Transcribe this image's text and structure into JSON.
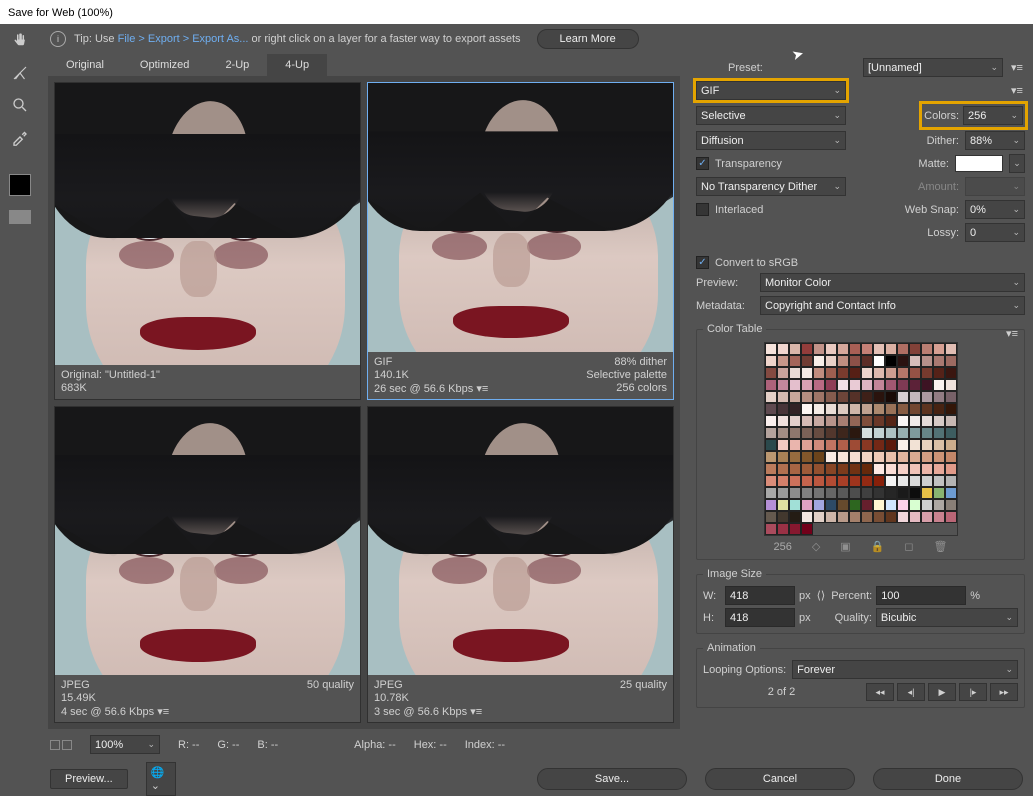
{
  "window": {
    "title": "Save for Web (100%)"
  },
  "tip": {
    "prefix": "Tip: Use ",
    "path": "File > Export > Export As...",
    "suffix": "  or right click on a layer for a faster way to export assets",
    "learn_more": "Learn More"
  },
  "tabs": {
    "original": "Original",
    "optimized": "Optimized",
    "two_up": "2-Up",
    "four_up": "4-Up"
  },
  "cells": [
    {
      "l1": "Original: \"Untitled-1\"",
      "r1": "",
      "l2": "683K",
      "r2": "",
      "l3": "",
      "r3": ""
    },
    {
      "l1": "GIF",
      "r1": "88% dither",
      "l2": "140.1K",
      "r2": "Selective palette",
      "l3": "26 sec @ 56.6 Kbps",
      "r3": "256 colors",
      "menu": "▾≡"
    },
    {
      "l1": "JPEG",
      "r1": "50 quality",
      "l2": "15.49K",
      "r2": "",
      "l3": "4 sec @ 56.6 Kbps",
      "r3": "",
      "menu": "▾≡"
    },
    {
      "l1": "JPEG",
      "r1": "25 quality",
      "l2": "10.78K",
      "r2": "",
      "l3": "3 sec @ 56.6 Kbps",
      "r3": "",
      "menu": "▾≡"
    }
  ],
  "settings": {
    "preset_label": "Preset:",
    "preset_value": "[Unnamed]",
    "format": "GIF",
    "reduction": "Selective",
    "colors_label": "Colors:",
    "colors_value": "256",
    "dithering": "Diffusion",
    "dither_label": "Dither:",
    "dither_value": "88%",
    "transparency_label": "Transparency",
    "matte_label": "Matte:",
    "trans_dither": "No Transparency Dither",
    "amount_label": "Amount:",
    "amount_value": "",
    "interlaced_label": "Interlaced",
    "websnap_label": "Web Snap:",
    "websnap_value": "0%",
    "lossy_label": "Lossy:",
    "lossy_value": "0",
    "convert_srgb": "Convert to sRGB",
    "preview_label": "Preview:",
    "preview_value": "Monitor Color",
    "metadata_label": "Metadata:",
    "metadata_value": "Copyright and Contact Info"
  },
  "color_table": {
    "legend": "Color Table",
    "count": "256"
  },
  "image_size": {
    "legend": "Image Size",
    "w_label": "W:",
    "w_value": "418",
    "w_unit": "px",
    "h_label": "H:",
    "h_value": "418",
    "h_unit": "px",
    "percent_label": "Percent:",
    "percent_value": "100",
    "percent_unit": "%",
    "quality_label": "Quality:",
    "quality_value": "Bicubic"
  },
  "animation": {
    "legend": "Animation",
    "loop_label": "Looping Options:",
    "loop_value": "Forever",
    "counter": "2 of 2"
  },
  "status": {
    "zoom": "100%",
    "r": "R: --",
    "g": "G: --",
    "b": "B: --",
    "alpha": "Alpha: --",
    "hex": "Hex: --",
    "index": "Index: --"
  },
  "buttons": {
    "preview": "Preview...",
    "save": "Save...",
    "cancel": "Cancel",
    "done": "Done"
  },
  "palette": [
    "#f6e3dc",
    "#f1d6cf",
    "#d9b6aa",
    "#933d3b",
    "#c29389",
    "#e9c9c0",
    "#d6a79b",
    "#a85f55",
    "#c58076",
    "#e3bfb5",
    "#dbb0a3",
    "#b06e63",
    "#824138",
    "#ba7e72",
    "#d69f92",
    "#e1bdb3",
    "#efd4cb",
    "#c8978a",
    "#a3655a",
    "#713d34",
    "#f8efe9",
    "#e9d1c8",
    "#bf8e81",
    "#8c5148",
    "#5d2e27",
    "#ffffff",
    "#000000",
    "#2a1210",
    "#d6bdb9",
    "#b6908a",
    "#a97971",
    "#9d6a61",
    "#844a41",
    "#caa39c",
    "#e9dbd6",
    "#f4e9e4",
    "#c18d7f",
    "#9f5f50",
    "#7a3b2e",
    "#561f15",
    "#edd5cd",
    "#deb9ae",
    "#ce9e91",
    "#b57769",
    "#955245",
    "#763a2e",
    "#552218",
    "#3a1610",
    "#ad627a",
    "#c4879c",
    "#e4bfcd",
    "#d9a0b3",
    "#b96a84",
    "#8f3d57",
    "#f3e0e7",
    "#e9cbd5",
    "#deb4c3",
    "#c28598",
    "#a15872",
    "#7f3a54",
    "#5c2238",
    "#3d1323",
    "#faf3f0",
    "#f0e3dd",
    "#e4d0c7",
    "#d5bab0",
    "#c8a79b",
    "#b58e80",
    "#9e7567",
    "#855c4e",
    "#6d4539",
    "#553128",
    "#3e2018",
    "#2a130d",
    "#190a06",
    "#d7cfd2",
    "#c4b8bd",
    "#ac9aa1",
    "#927c83",
    "#786168",
    "#5f4a50",
    "#483539",
    "#322225",
    "#fdf7f3",
    "#f4ece6",
    "#e9ddd6",
    "#ddcac0",
    "#cfb6a9",
    "#bfa190",
    "#ab896f",
    "#997258",
    "#865c43",
    "#724731",
    "#5d3420",
    "#472312",
    "#331608",
    "#faf0ee",
    "#efe0dd",
    "#e3cfcb",
    "#d6bcb6",
    "#c7a9a2",
    "#b7948b",
    "#a77e72",
    "#936656",
    "#7f4e3b",
    "#6a3828",
    "#552516",
    "#f9f6f5",
    "#f0eae8",
    "#e4dbd8",
    "#d6cac6",
    "#c7b8b3",
    "#b5a39d",
    "#a28d85",
    "#8f776d",
    "#7b6157",
    "#674c41",
    "#52372d",
    "#3e261c",
    "#2b180f",
    "#d4e0e0",
    "#c2d2d3",
    "#aec2c3",
    "#97afb0",
    "#7f9b9d",
    "#688688",
    "#527275",
    "#3d5d60",
    "#2b494c",
    "#f3c9c3",
    "#eab5ad",
    "#dfa095",
    "#d18a7b",
    "#c27462",
    "#b15f4a",
    "#9e4b35",
    "#893823",
    "#732816",
    "#5c1a0b",
    "#fbf0e8",
    "#f2e2d5",
    "#e7d2be",
    "#dac0a6",
    "#ccad8c",
    "#bb9770",
    "#a98156",
    "#966c3f",
    "#82572b",
    "#6c441b",
    "#f9ece5",
    "#f8e5db",
    "#f5ddd0",
    "#f1d4c4",
    "#edcab8",
    "#e8c0ab",
    "#e2b59e",
    "#dbaa91",
    "#d39e83",
    "#cc9376",
    "#c48769",
    "#bb7b5c",
    "#b17050",
    "#a76544",
    "#9d5b39",
    "#92502f",
    "#874525",
    "#7c3b1c",
    "#713213",
    "#66290b",
    "#fce9e4",
    "#f9ddd6",
    "#f5d0c7",
    "#f1c3b8",
    "#ecb5a8",
    "#e7a899",
    "#e19a89",
    "#da8c79",
    "#d37f6a",
    "#cc715b",
    "#c4644d",
    "#bb573f",
    "#b24b33",
    "#a83f27",
    "#9e341d",
    "#932a13",
    "#87200a",
    "#f3f3f3",
    "#e7e7e7",
    "#dadada",
    "#cecece",
    "#c1c1c1",
    "#b4b4b4",
    "#a7a7a7",
    "#9a9a9a",
    "#8d8d8d",
    "#808080",
    "#737373",
    "#666666",
    "#595959",
    "#4d4d4d",
    "#404040",
    "#333333",
    "#262626",
    "#1a1a1a",
    "#0d0d0d",
    "#e7c047",
    "#88b371",
    "#6d9bd1",
    "#b58fd6",
    "#e0e0a1",
    "#a1e0d7",
    "#e0a1c4",
    "#a1a6e0",
    "#2d4a66",
    "#664a2d",
    "#2d661f",
    "#661f2d",
    "#fff6d1",
    "#d1e7ff",
    "#ffd1ea",
    "#d8ffd1",
    "#cececf",
    "#ada7a2",
    "#897f77",
    "#655a4f",
    "#42382e",
    "#241c14",
    "#f2e7e2",
    "#e0cfc6",
    "#cdb5a8",
    "#b99b8a",
    "#a4806b",
    "#8e664e",
    "#784d34",
    "#61361e",
    "#f1d7db",
    "#e4bac2",
    "#d79ea9",
    "#c9828f",
    "#ba6676",
    "#aa4b5d",
    "#993145",
    "#86182f",
    "#72001a"
  ]
}
